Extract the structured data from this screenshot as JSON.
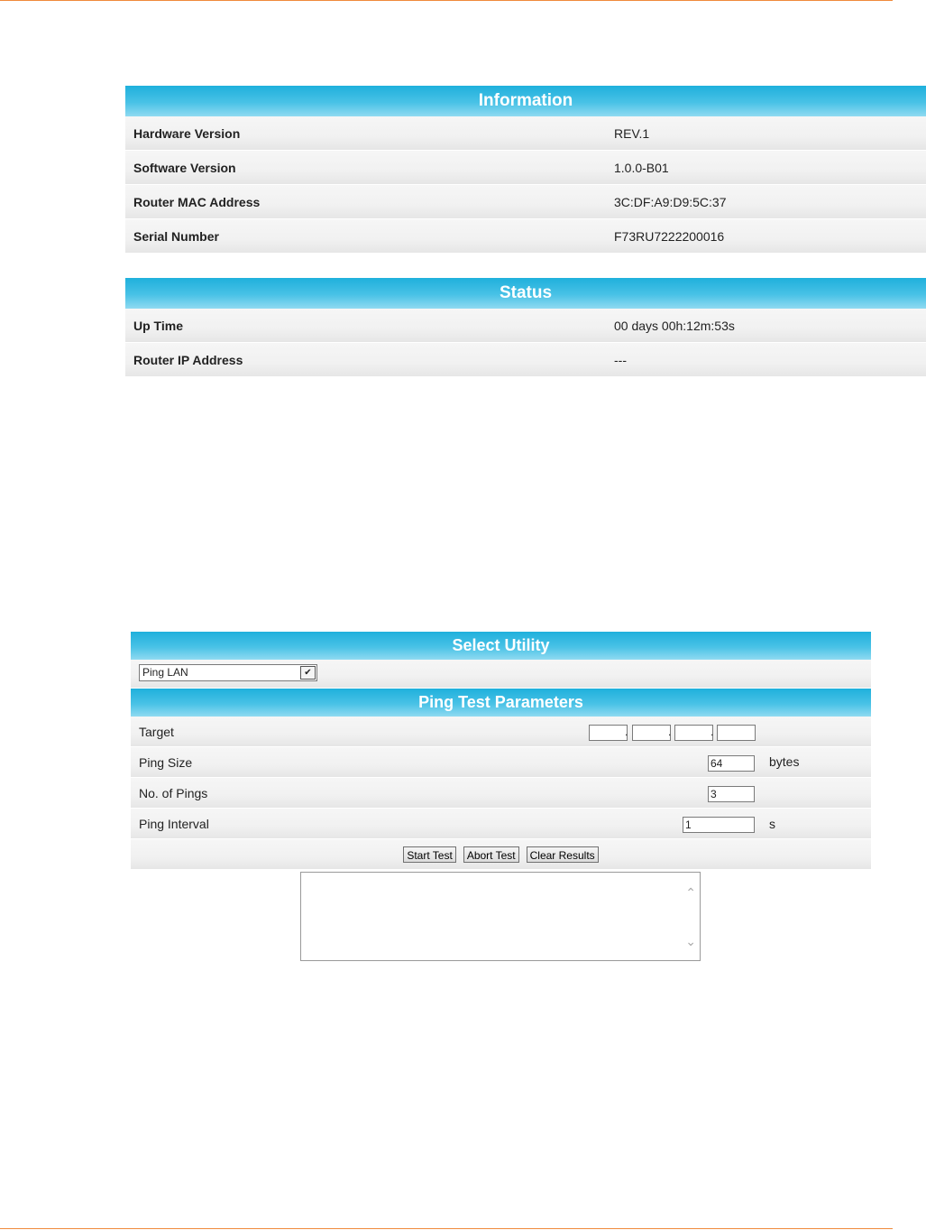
{
  "information": {
    "title": "Information",
    "rows": [
      {
        "label": "Hardware Version",
        "value": "REV.1"
      },
      {
        "label": "Software Version",
        "value": "1.0.0-B01"
      },
      {
        "label": "Router MAC Address",
        "value": "3C:DF:A9:D9:5C:37"
      },
      {
        "label": "Serial Number",
        "value": "F73RU7222200016"
      }
    ]
  },
  "status": {
    "title": "Status",
    "rows": [
      {
        "label": "Up Time",
        "value": "00 days 00h:12m:53s"
      },
      {
        "label": "Router IP Address",
        "value": "---"
      }
    ]
  },
  "utility": {
    "title": "Select Utility",
    "selected": "Ping LAN"
  },
  "ping": {
    "title": "Ping Test Parameters",
    "target_label": "Target",
    "size_label": "Ping Size",
    "size_value": "64",
    "size_unit": "bytes",
    "count_label": "No. of Pings",
    "count_value": "3",
    "interval_label": "Ping Interval",
    "interval_value": "1",
    "interval_unit": "s",
    "buttons": {
      "start": "Start Test",
      "abort": "Abort Test",
      "clear": "Clear Results"
    }
  },
  "colors": {
    "header": "#1fb0dc",
    "rule": "#f08a3c"
  }
}
